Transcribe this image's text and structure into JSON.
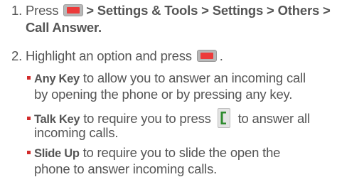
{
  "steps": {
    "step1": {
      "number": "1.",
      "press": "Press",
      "sep1": ">",
      "settings_tools": "Settings & Tools",
      "sep2": ">",
      "settings": "Settings",
      "sep3": ">",
      "others": "Others",
      "sep4": ">",
      "call_answer": "Call Answer."
    },
    "step2": {
      "number": "2.",
      "text_before": "Highlight an option and press",
      "text_after": "."
    }
  },
  "options": [
    {
      "label": "Any Key",
      "line1": "to allow you to answer an incoming call",
      "line2": "by opening the phone or by pressing any key."
    },
    {
      "label": "Talk Key",
      "line1_before": "to require you to press",
      "line1_after": "to answer all",
      "line2": "incoming calls."
    },
    {
      "label": "Slide Up",
      "line1": "to require you to slide the open the",
      "line2": "phone to answer incoming calls."
    }
  ],
  "colors": {
    "text": "#555555",
    "bullet": "#d22b2b",
    "menu_key": "#ec3a3a",
    "talk_key": "#2e8b2e"
  },
  "icons": {
    "menu_key": "menu-ok-key-icon",
    "talk_key": "talk-key-icon"
  }
}
